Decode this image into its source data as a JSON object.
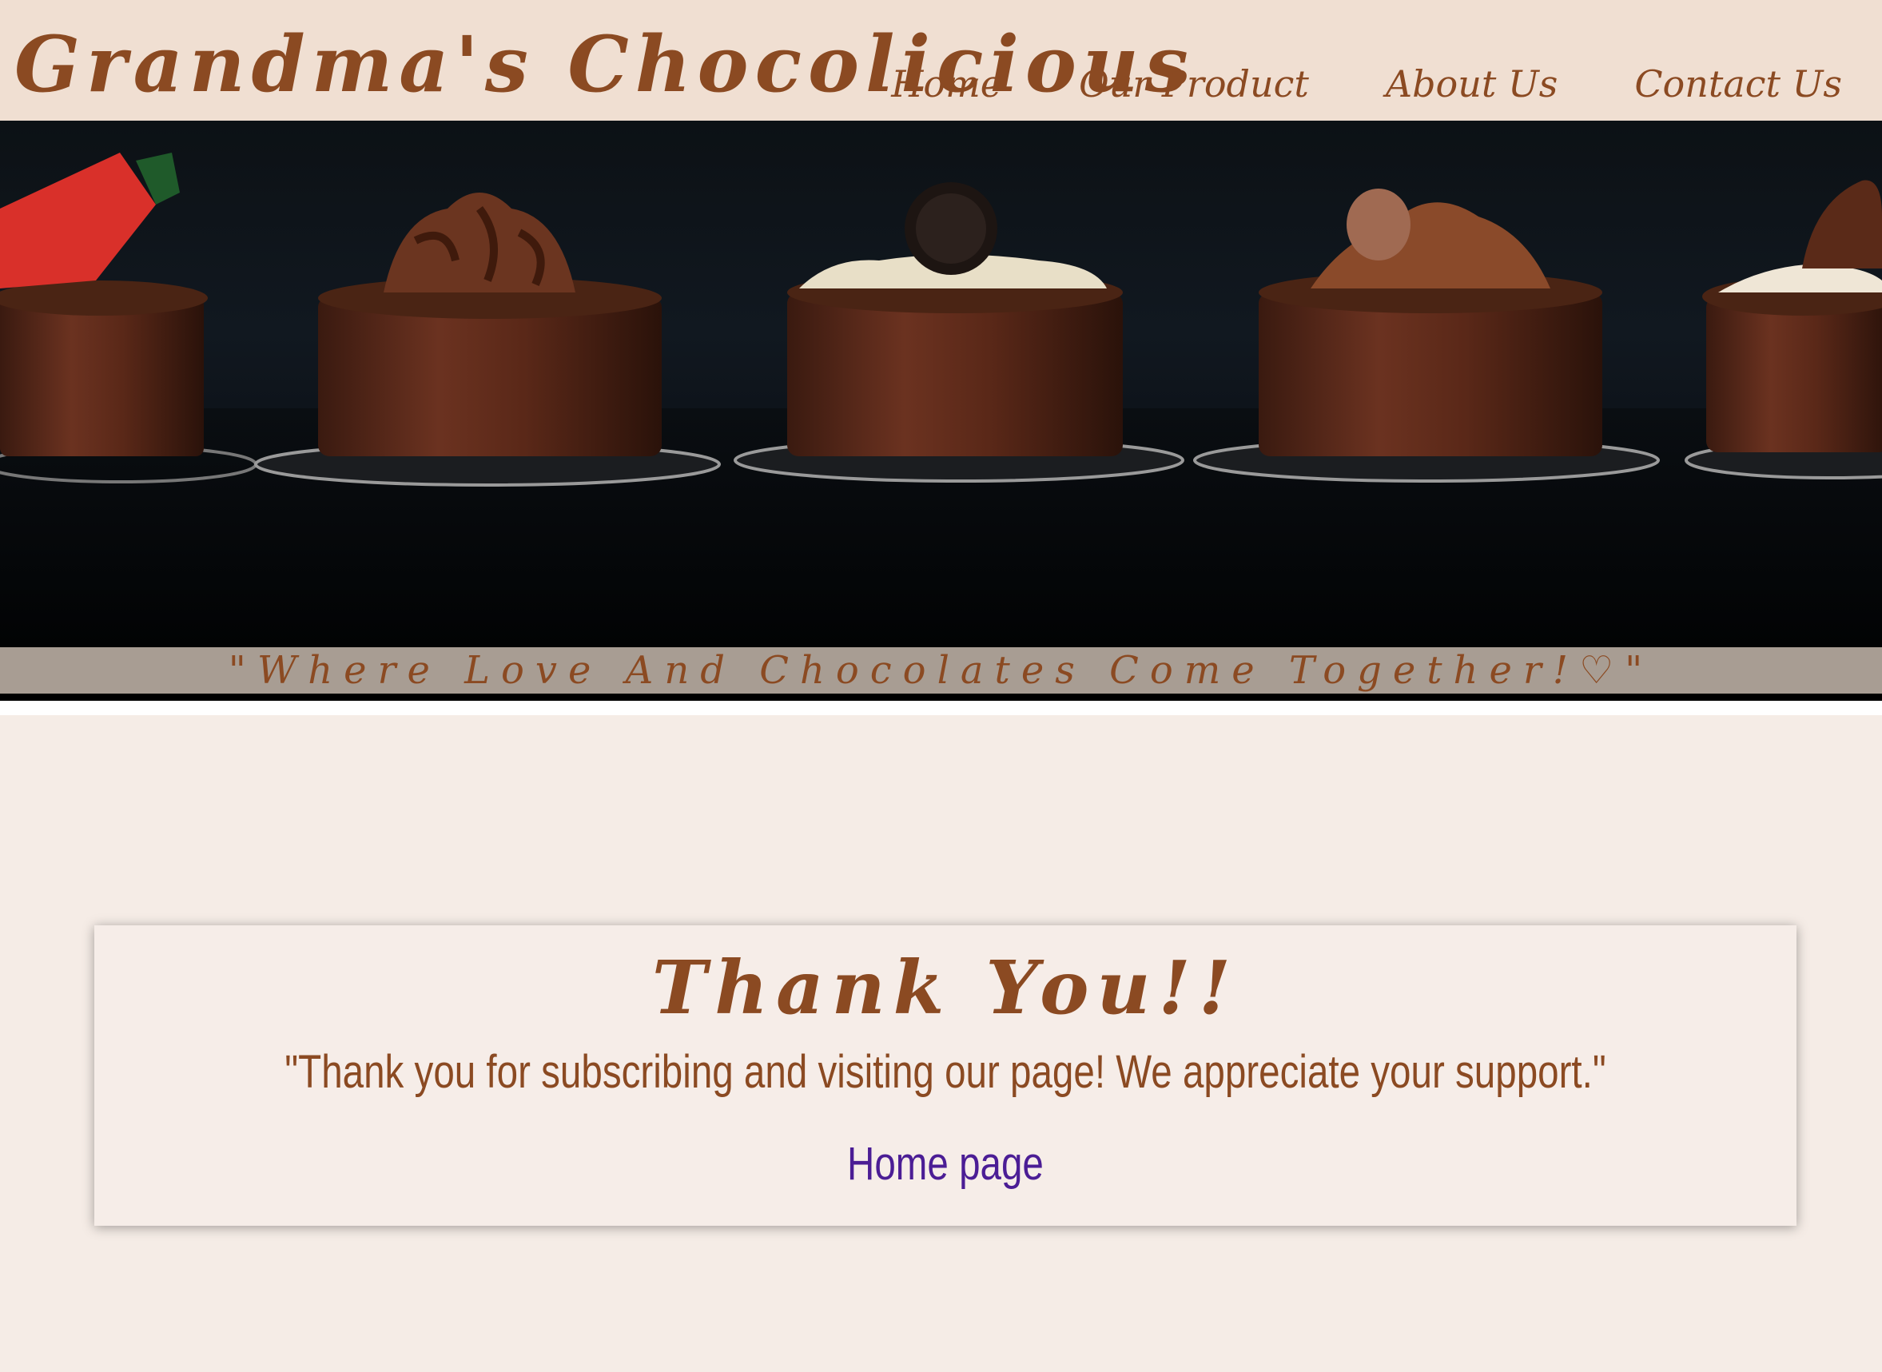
{
  "header": {
    "title": "Grandma's Chocolicious",
    "nav": [
      "Home",
      "Our Product",
      "About Us",
      "Contact Us"
    ]
  },
  "hero": {
    "image_description": "chocolate-cups-dessert-photo",
    "tagline": "\"Where Love And Chocolates Come Together!♡\""
  },
  "card": {
    "title": "Thank You!!",
    "message": "\"Thank you for subscribing and visiting our page! We appreciate your support.\"",
    "link_label": "Home page"
  },
  "colors": {
    "brand": "#8b4a22",
    "header_bg": "#f0dfd2",
    "page_bg": "#f5ece6",
    "link": "#4b1d95"
  }
}
